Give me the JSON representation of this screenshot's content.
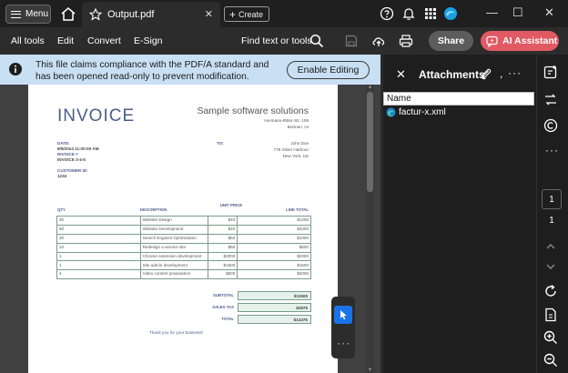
{
  "titlebar": {
    "menu_label": "Menu",
    "tab_title": "Output.pdf",
    "tab_close": "✕",
    "create_label": "Create",
    "create_plus": "+",
    "win_minimize": "—",
    "win_maximize": "☐",
    "win_close": "✕"
  },
  "toolbar": {
    "items": [
      "All tools",
      "Edit",
      "Convert",
      "E-Sign"
    ],
    "find_label": "Find text or tools",
    "share_label": "Share",
    "ai_label": "AI Assistant"
  },
  "banner": {
    "message": "This file claims compliance with the PDF/A standard and has been opened read-only to prevent modification.",
    "button_label": "Enable Editing"
  },
  "invoice": {
    "title": "INVOICE",
    "company": "Sample software solutions",
    "company_address": [
      "Hermann-Ritter-Str. 108",
      "Bremen, UI"
    ],
    "date_label": "DATE:",
    "date_value": "8/9/2024 11:00:00 AM",
    "invoice_no_label": "INVOICE #",
    "invoice_no_value": "INVOICE 3-4-5",
    "customer_id_label": "CUSTOMER ID:",
    "customer_id_value": "1234",
    "to_label": "TO:",
    "to_address": [
      "John Doe",
      "776 Silver Harbour",
      "New York, US"
    ],
    "columns": [
      "QTY",
      "DESCRIPTION",
      "UNIT PRICE",
      "LINE TOTAL"
    ],
    "rows": [
      [
        "30",
        "Website Design",
        "$40",
        "$1200"
      ],
      [
        "80",
        "Website Development",
        "$40",
        "$3200"
      ],
      [
        "20",
        "Search Engines Optimization",
        "$50",
        "$1000"
      ],
      [
        "10",
        "Redesign a service site",
        "$60",
        "$600"
      ],
      [
        "1",
        "Chrome extension development",
        "$2000",
        "$2000"
      ],
      [
        "1",
        "Site admin development",
        "$1500",
        "$1500"
      ],
      [
        "4",
        "Video content preparation",
        "$500",
        "$2000"
      ]
    ],
    "subtotal_label": "SUBTOTAL",
    "subtotal_value": "$11500",
    "tax_label": "SALES TAX",
    "tax_value": "$2875",
    "total_label": "TOTAL",
    "total_value": "$14375",
    "thanks": "Thank you for your business!"
  },
  "attachments": {
    "close": "✕",
    "title": "Attachments",
    "comma": ",",
    "more": "···",
    "column_name": "Name",
    "files": [
      "factur-x.xml"
    ]
  },
  "floatbar": {
    "more": "···"
  },
  "rail": {
    "current_page": "1",
    "total_pages": "1",
    "more": "···"
  },
  "colors": {
    "banner_bg": "#c9e0f4",
    "ai_button": "#e15a63",
    "invoice_accent": "#4b5d8a",
    "table_border": "#7a9c8e",
    "select_tool": "#1a73e8"
  }
}
